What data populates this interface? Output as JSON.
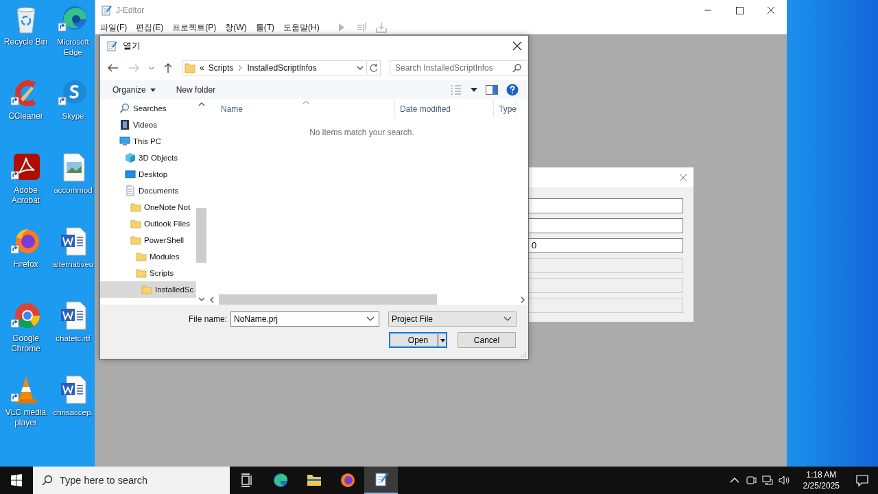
{
  "desktop": {
    "icons": [
      {
        "label": "Recycle Bin",
        "kind": "recycle-bin",
        "shortcut": false
      },
      {
        "label": "Microsoft Edge",
        "kind": "edge",
        "shortcut": true
      },
      {
        "label": "CCleaner",
        "kind": "ccleaner",
        "shortcut": true
      },
      {
        "label": "Skype",
        "kind": "skype",
        "shortcut": true
      },
      {
        "label": "Adobe Acrobat",
        "kind": "acrobat",
        "shortcut": true
      },
      {
        "label": "accommod",
        "kind": "image-file",
        "shortcut": false
      },
      {
        "label": "Firefox",
        "kind": "firefox",
        "shortcut": true
      },
      {
        "label": "alternativeu",
        "kind": "word-file",
        "shortcut": false
      },
      {
        "label": "Google Chrome",
        "kind": "chrome",
        "shortcut": true
      },
      {
        "label": "chatetc.rtf",
        "kind": "word-file",
        "shortcut": false
      },
      {
        "label": "VLC media player",
        "kind": "vlc",
        "shortcut": true
      },
      {
        "label": "chrisaccep.",
        "kind": "word-file",
        "shortcut": false
      }
    ]
  },
  "editor": {
    "title": "J-Editor",
    "menus": [
      "파일(F)",
      "편집(E)",
      "프로젝트(P)",
      "창(W)",
      "툴(T)",
      "도움말(H)"
    ],
    "toolbar": [
      {
        "kind": "run",
        "disabled": true
      },
      {
        "kind": "step",
        "disabled": true
      },
      {
        "kind": "deploy",
        "disabled": true
      }
    ]
  },
  "background_dialog": {
    "fields": [
      {
        "disabled": false
      },
      {
        "disabled": false
      },
      {
        "value": "0",
        "disabled": false
      },
      {
        "disabled": true
      },
      {
        "disabled": true
      },
      {
        "disabled": true
      }
    ]
  },
  "open_dialog": {
    "title": "열기",
    "nav_buttons": [
      {
        "kind": "back",
        "disabled": false
      },
      {
        "kind": "forward",
        "disabled": true
      },
      {
        "kind": "recent",
        "disabled": false
      },
      {
        "kind": "up",
        "disabled": false
      }
    ],
    "address": {
      "overflow": "«",
      "path": [
        "Scripts",
        "InstalledScriptInfos"
      ]
    },
    "search": {
      "placeholder": "Search InstalledScriptInfos"
    },
    "commands": [
      {
        "label": "Organize",
        "dropdown": true
      },
      {
        "label": "New folder",
        "dropdown": false
      }
    ],
    "tree": [
      {
        "label": "Searches",
        "kind": "search",
        "selected": false
      },
      {
        "label": "Videos",
        "kind": "videos",
        "selected": false
      },
      {
        "label": "This PC",
        "kind": "pc",
        "selected": false,
        "children": [
          {
            "label": "3D Objects",
            "kind": "cube",
            "selected": false
          },
          {
            "label": "Desktop",
            "kind": "desktop",
            "selected": false
          },
          {
            "label": "Documents",
            "kind": "document",
            "selected": false,
            "children": [
              {
                "label": "OneNote Not",
                "kind": "folder",
                "selected": false
              },
              {
                "label": "Outlook Files",
                "kind": "folder",
                "selected": false
              },
              {
                "label": "PowerShell",
                "kind": "folder",
                "selected": false,
                "children": [
                  {
                    "label": "Modules",
                    "kind": "folder",
                    "selected": false
                  },
                  {
                    "label": "Scripts",
                    "kind": "folder",
                    "selected": false,
                    "children": [
                      {
                        "label": "InstalledSc",
                        "kind": "folder",
                        "selected": true
                      }
                    ]
                  }
                ]
              }
            ]
          }
        ]
      }
    ],
    "columns": [
      {
        "label": "Name",
        "sorted": true
      },
      {
        "label": "Date modified",
        "sorted": false
      },
      {
        "label": "Type",
        "sorted": false
      }
    ],
    "empty_message": "No items match your search.",
    "file_name": {
      "label": "File name:",
      "value": "NoName.prj"
    },
    "file_type": {
      "value": "Project File"
    },
    "buttons": [
      {
        "label": "Open",
        "default": true,
        "split": true
      },
      {
        "label": "Cancel",
        "default": false,
        "split": false
      }
    ]
  },
  "taskbar": {
    "search": {
      "placeholder": "Type here to search"
    },
    "apps": [
      {
        "kind": "task-view",
        "selected": false
      },
      {
        "kind": "edge",
        "selected": false
      },
      {
        "kind": "explorer",
        "selected": false
      },
      {
        "kind": "firefox",
        "selected": false
      },
      {
        "kind": "editor",
        "selected": true
      }
    ],
    "tray": [
      {
        "kind": "chevron"
      },
      {
        "kind": "meet"
      },
      {
        "kind": "network"
      },
      {
        "kind": "volume"
      }
    ],
    "clock": {
      "time": "1:18 AM",
      "date": "2/25/2025"
    }
  }
}
